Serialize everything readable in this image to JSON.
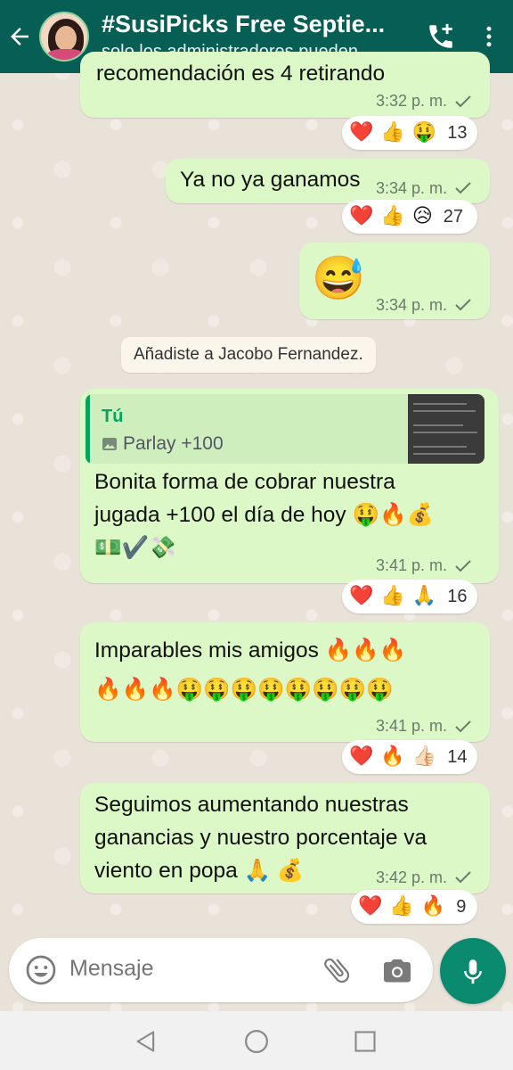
{
  "header": {
    "title": "#SusiPicks Free Septie...",
    "subtitle": "solo los administradores pueden..."
  },
  "messages": [
    {
      "text": "recomendación es 4 retirando",
      "time": "3:32 p. m.",
      "reactions": [
        "❤️",
        "👍",
        "🤑"
      ],
      "reaction_count": "13"
    },
    {
      "text": "Ya no ya ganamos",
      "time": "3:34 p. m.",
      "reactions": [
        "❤️",
        "👍",
        "😥"
      ],
      "reaction_count": "27"
    },
    {
      "text": "😅",
      "time": "3:34 p. m."
    },
    {
      "quote_author": "Tú",
      "quote_text": "Parlay +100",
      "text": "Bonita forma de cobrar nuestra\njugada +100 el día de hoy 🤑🔥💰\n💵✔️💸",
      "time": "3:41 p. m.",
      "reactions": [
        "❤️",
        "👍",
        "🙏"
      ],
      "reaction_count": "16"
    },
    {
      "text": "Imparables mis amigos 🔥🔥🔥\n🔥🔥🔥🤑🤑🤑🤑🤑🤑🤑🤑",
      "time": "3:41 p. m.",
      "reactions": [
        "❤️",
        "🔥",
        "👍🏻"
      ],
      "reaction_count": "14"
    },
    {
      "text": "Seguimos aumentando nuestras\nganancias y nuestro porcentaje va\nviento en popa 🙏 💰",
      "time": "3:42 p. m.",
      "reactions": [
        "❤️",
        "👍",
        "🔥"
      ],
      "reaction_count": "9"
    }
  ],
  "system_note": "Añadiste a Jacobo Fernandez.",
  "composer": {
    "placeholder": "Mensaje"
  },
  "icons": {
    "back": "arrow-back-icon",
    "call": "add-call-icon",
    "menu": "more-vert-icon",
    "emoji": "emoji-icon",
    "attach": "paperclip-icon",
    "camera": "camera-icon",
    "mic": "mic-icon",
    "read_receipt": "check-icon",
    "image": "image-icon"
  },
  "colors": {
    "header": "#075e54",
    "bubble_out": "#dcf8c6",
    "accent": "#06a35d",
    "mic_button": "#0a8a6f"
  }
}
